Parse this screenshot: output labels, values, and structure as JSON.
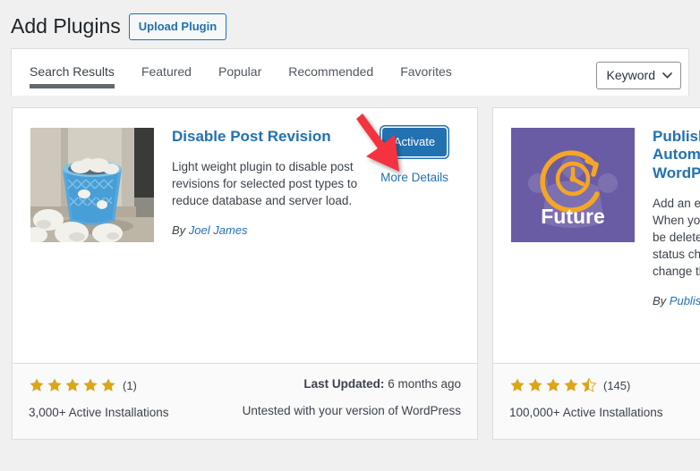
{
  "header": {
    "title": "Add Plugins",
    "upload_button": "Upload Plugin"
  },
  "tabs": [
    {
      "label": "Search Results",
      "active": true
    },
    {
      "label": "Featured",
      "active": false
    },
    {
      "label": "Popular",
      "active": false
    },
    {
      "label": "Recommended",
      "active": false
    },
    {
      "label": "Favorites",
      "active": false
    }
  ],
  "search_filter": {
    "selected": "Keyword",
    "icon": "chevron-down-icon"
  },
  "cards": [
    {
      "name": "Disable Post Revision",
      "description": "Light weight plugin to disable post revisions for selected post types to reduce database and server load.",
      "author_prefix": "By ",
      "author": "Joel James",
      "action_label": "Activate",
      "details_label": "More Details",
      "rating_stars": 5,
      "rating_count": "(1)",
      "installs": "3,000+ Active Installations",
      "updated_label": "Last Updated:",
      "updated_value": " 6 months ago",
      "compatibility": "Untested with your version of WordPress",
      "thumb_type": "photo-wastebasket"
    },
    {
      "name": "PublishPress Future: Automatically Unpublish WordPress Posts",
      "description": "Add an expiration date to posts. When your post is unpublished, it can be deleted, trashed, or have the post status changed. It's also possible to change the post categories.",
      "author_prefix": "By ",
      "author": "PublishPress",
      "rating_stars": 4.5,
      "rating_count": "(145)",
      "installs": "100,000+ Active Installations",
      "thumb_type": "future-logo",
      "thumb_text": "Future"
    }
  ],
  "colors": {
    "accent_blue": "#2271b1",
    "page_bg": "#f0f0f1",
    "star_gold": "#dba617",
    "arrow_red": "#f5333f",
    "future_purple": "#6a5ba5"
  }
}
